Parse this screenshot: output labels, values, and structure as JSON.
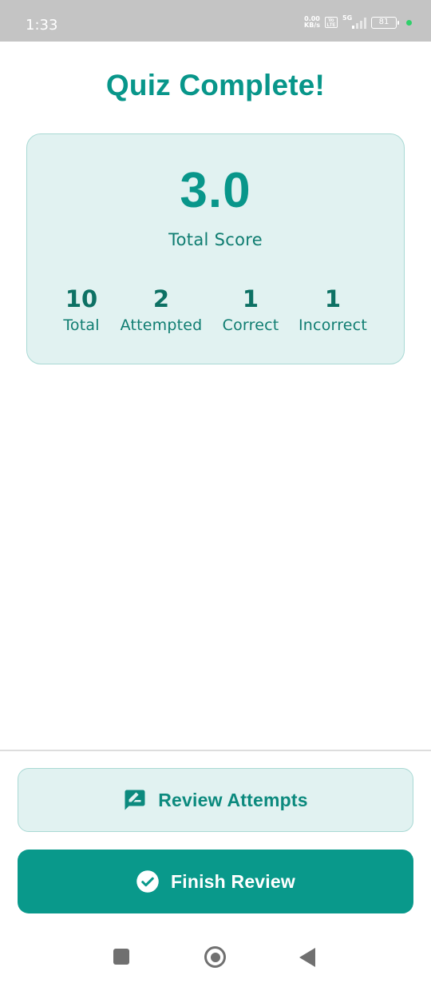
{
  "status_bar": {
    "time": "1:33",
    "net_speed_value": "0.00",
    "net_speed_unit": "KB/s",
    "volte_top": "Vo",
    "volte_bottom": "LTE",
    "network": "5G",
    "battery": "81"
  },
  "page": {
    "title": "Quiz Complete!"
  },
  "score": {
    "value": "3.0",
    "label": "Total Score"
  },
  "stats": [
    {
      "value": "10",
      "label": "Total"
    },
    {
      "value": "2",
      "label": "Attempted"
    },
    {
      "value": "1",
      "label": "Correct"
    },
    {
      "value": "1",
      "label": "Incorrect"
    }
  ],
  "actions": {
    "review_label": "Review Attempts",
    "review_icon": "rate-review-icon",
    "finish_label": "Finish Review",
    "finish_icon": "check-circle-icon"
  },
  "colors": {
    "accent": "#08968a",
    "card_bg": "#e1f2f1",
    "primary_button": "#09998b"
  }
}
